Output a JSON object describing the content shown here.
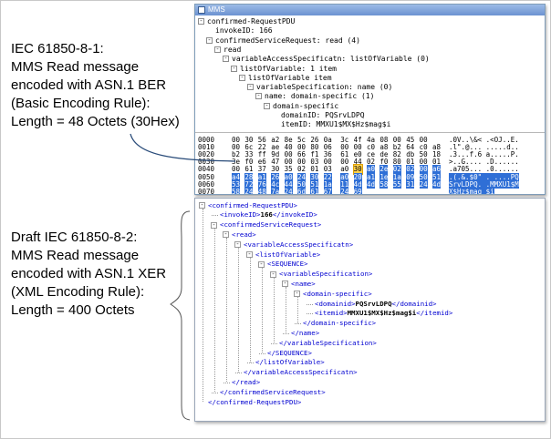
{
  "captions": {
    "ber": [
      "IEC 61850-8-1:",
      "MMS Read message",
      "encoded with ASN.1 BER",
      "(Basic Encoding Rule):",
      "Length = 48 Octets (30Hex)"
    ],
    "xer": [
      "Draft IEC 61850-8-2:",
      "MMS Read message",
      "encoded with ASN.1 XER",
      "(XML Encoding Rule):",
      "Length = 400 Octets"
    ]
  },
  "ws": {
    "title": "MMS",
    "tree": [
      {
        "depth": 0,
        "box": "-",
        "text": "confirmed-RequestPDU"
      },
      {
        "depth": 1,
        "box": "",
        "text": "invokeID: 166"
      },
      {
        "depth": 1,
        "box": "-",
        "text": "confirmedServiceRequest: read (4)"
      },
      {
        "depth": 2,
        "box": "-",
        "text": "read"
      },
      {
        "depth": 3,
        "box": "-",
        "text": "variableAccessSpecificatn: listOfVariable (0)"
      },
      {
        "depth": 4,
        "box": "-",
        "text": "listOfVariable: 1 item"
      },
      {
        "depth": 5,
        "box": "-",
        "text": "listOfVariable item"
      },
      {
        "depth": 6,
        "box": "-",
        "text": "variableSpecification: name (0)"
      },
      {
        "depth": 7,
        "box": "-",
        "text": "name: domain-specific (1)"
      },
      {
        "depth": 8,
        "box": "-",
        "text": "domain-specific"
      },
      {
        "depth": 9,
        "box": "",
        "text": "domainID: PQSrvLDPQ"
      },
      {
        "depth": 9,
        "box": "",
        "text": "itemID: MMXU1$MX$Hz$mag$i"
      }
    ],
    "hex": [
      {
        "off": "0000",
        "bytes": "00 30 56 a2 8e 5c 26 0a 3c 4f 4a 08 00 45 00",
        "ascii": ".0V..\\&< .<OJ..E."
      },
      {
        "off": "0010",
        "bytes": "00 6c 22 ae 40 00 80 06 00 00 c0 a8 b2 64 c0 a8",
        "ascii": ".l\".@... .....d.."
      },
      {
        "off": "0020",
        "bytes": "b2 33 ff 9d 00 66 f1 36 61 e0 ce de 82 db 50 18",
        "ascii": ".3...f.6 a.....P."
      },
      {
        "off": "0030",
        "bytes": "3e f0 e6 47 00 00 03 00 00 44 02 f0 80 01 00 01",
        "ascii": ">..G.... .D......"
      },
      {
        "off": "0040",
        "bytes": "00 61 37 30 35 02 01 03 a0 30 a0 2e 02 02 00 a6",
        "ascii": ".a705... .0......"
      },
      {
        "off": "0050",
        "bytes": "a4 28 a1 26 a0 24 30 22 a0 20 a1 1e 1a 09 50 51",
        "ascii": ".(.&.$0\" . ....PQ"
      },
      {
        "off": "0060",
        "bytes": "53 72 76 4c 44 50 51 1a 11 4d 4d 58 55 31 24 4d",
        "ascii": "SrvLDPQ. .MMXU1$M"
      },
      {
        "off": "0070",
        "bytes": "58 24 48 7a 24 6d 61 67 24 69",
        "ascii": "X$Hz$mag $i"
      }
    ]
  },
  "xml": {
    "lines": [
      {
        "depth": 0,
        "minus": true,
        "parts": [
          {
            "t": "tag",
            "s": "<confirmed-RequestPDU>"
          }
        ]
      },
      {
        "depth": 1,
        "minus": false,
        "parts": [
          {
            "t": "tag",
            "s": "<invokeID>"
          },
          {
            "t": "val",
            "s": "166"
          },
          {
            "t": "tag",
            "s": "</invokeID>"
          }
        ]
      },
      {
        "depth": 1,
        "minus": true,
        "parts": [
          {
            "t": "tag",
            "s": "<confirmedServiceRequest>"
          }
        ]
      },
      {
        "depth": 2,
        "minus": true,
        "parts": [
          {
            "t": "tag",
            "s": "<read>"
          }
        ]
      },
      {
        "depth": 3,
        "minus": true,
        "parts": [
          {
            "t": "tag",
            "s": "<variableAccessSpecificatn>"
          }
        ]
      },
      {
        "depth": 4,
        "minus": true,
        "parts": [
          {
            "t": "tag",
            "s": "<listOfVariable>"
          }
        ]
      },
      {
        "depth": 5,
        "minus": true,
        "parts": [
          {
            "t": "tag",
            "s": "<SEQUENCE>"
          }
        ]
      },
      {
        "depth": 6,
        "minus": true,
        "parts": [
          {
            "t": "tag",
            "s": "<variableSpecification>"
          }
        ]
      },
      {
        "depth": 7,
        "minus": true,
        "parts": [
          {
            "t": "tag",
            "s": "<name>"
          }
        ]
      },
      {
        "depth": 8,
        "minus": true,
        "parts": [
          {
            "t": "tag",
            "s": "<domain-specific>"
          }
        ]
      },
      {
        "depth": 9,
        "minus": false,
        "parts": [
          {
            "t": "tag",
            "s": "<domainid>"
          },
          {
            "t": "val",
            "s": "PQSrvLDPQ"
          },
          {
            "t": "tag",
            "s": "</domainid>"
          }
        ]
      },
      {
        "depth": 9,
        "minus": false,
        "parts": [
          {
            "t": "tag",
            "s": "<itemid>"
          },
          {
            "t": "val",
            "s": "MMXU1$MX$Hz$mag$i"
          },
          {
            "t": "tag",
            "s": "</itemid>"
          }
        ]
      },
      {
        "depth": 8,
        "minus": false,
        "parts": [
          {
            "t": "tag",
            "s": "</domain-specific>"
          }
        ]
      },
      {
        "depth": 7,
        "minus": false,
        "parts": [
          {
            "t": "tag",
            "s": "</name>"
          }
        ]
      },
      {
        "depth": 6,
        "minus": false,
        "parts": [
          {
            "t": "tag",
            "s": "</variableSpecification>"
          }
        ]
      },
      {
        "depth": 5,
        "minus": false,
        "parts": [
          {
            "t": "tag",
            "s": "</SEQUENCE>"
          }
        ]
      },
      {
        "depth": 4,
        "minus": false,
        "parts": [
          {
            "t": "tag",
            "s": "</listOfVariable>"
          }
        ]
      },
      {
        "depth": 3,
        "minus": false,
        "parts": [
          {
            "t": "tag",
            "s": "</variableAccessSpecificatn>"
          }
        ]
      },
      {
        "depth": 2,
        "minus": false,
        "parts": [
          {
            "t": "tag",
            "s": "</read>"
          }
        ]
      },
      {
        "depth": 1,
        "minus": false,
        "parts": [
          {
            "t": "tag",
            "s": "</confirmedServiceRequest>"
          }
        ]
      },
      {
        "depth": 0,
        "minus": false,
        "parts": [
          {
            "t": "tag",
            "s": "</confirmed-RequestPDU>"
          }
        ]
      }
    ]
  },
  "colors": {
    "tag": "#0000d0",
    "selection": "#2f6fd6",
    "highlight": "#ffd24d",
    "connector": "#2a4c7a"
  }
}
